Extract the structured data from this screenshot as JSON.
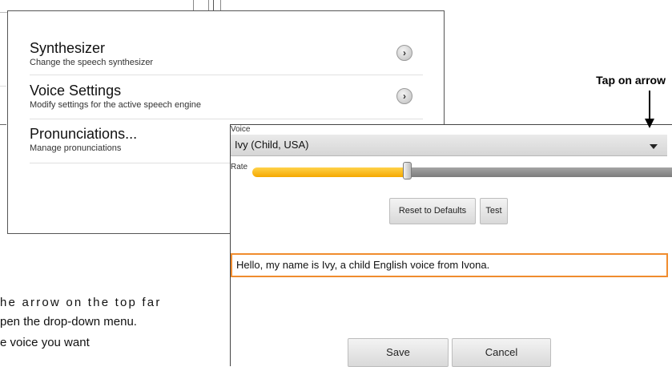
{
  "settings": {
    "items": [
      {
        "title": "Synthesizer",
        "subtitle": "Change the speech synthesizer",
        "icon": "chevron-right-icon"
      },
      {
        "title": "Voice Settings",
        "subtitle": "Modify settings for the active speech engine",
        "icon": "chevron-right-icon"
      },
      {
        "title": "Pronunciations...",
        "subtitle": "Manage pronunciations"
      }
    ]
  },
  "voice_dialog": {
    "voice_label": "Voice",
    "voice_value": "Ivy (Child, USA)",
    "rate_label": "Rate",
    "rate_level": 0.37,
    "reset_label": "Reset to Defaults",
    "test_label": "Test",
    "test_text": "Hello, my name is Ivy, a child English voice from Ivona.",
    "save_label": "Save",
    "cancel_label": "Cancel"
  },
  "annotation": {
    "tap_label": "Tap on arrow"
  },
  "instructions": {
    "line1": "he arrow on the top far",
    "line2": "pen the drop-down menu.",
    "line3": "e voice you want"
  },
  "colors": {
    "accent_orange": "#f08c2e",
    "slider_fill": "#f5a800"
  }
}
